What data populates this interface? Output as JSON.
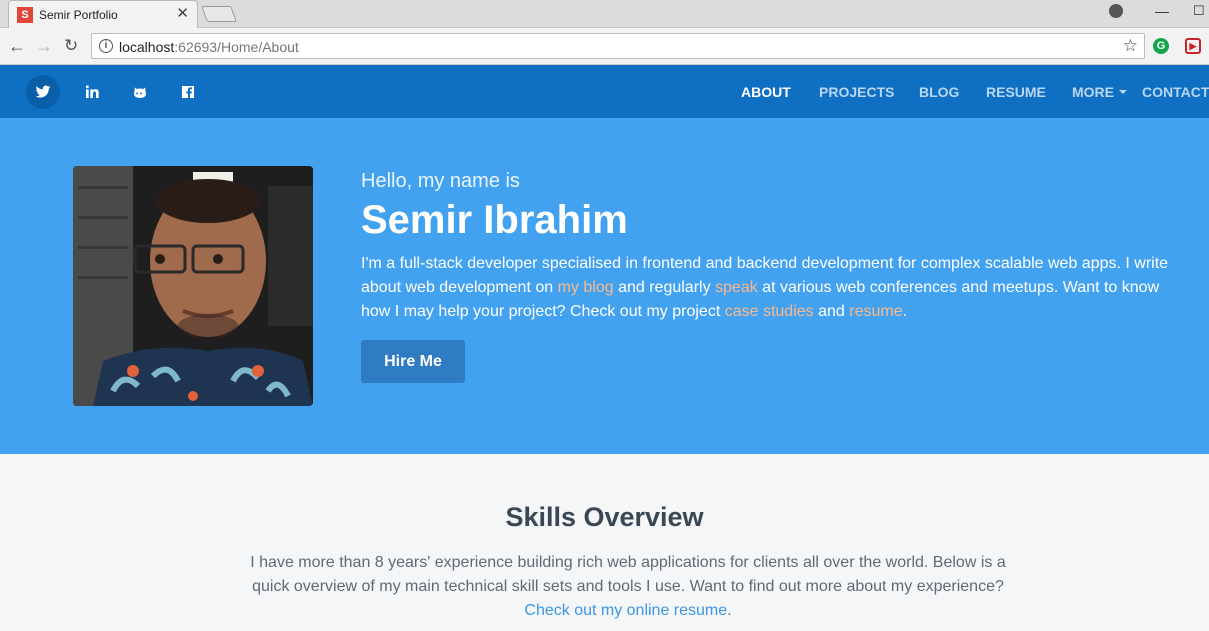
{
  "browser": {
    "tab_title": "Semir Portfolio",
    "tab_close": "✕",
    "favicon_letter": "S",
    "url_host": "localhost",
    "url_rest": ":62693/Home/About",
    "minimize": "—",
    "maximize": "☐",
    "close": "✕"
  },
  "nav": {
    "social_icons": [
      "twitter-icon",
      "linkedin-icon",
      "github-icon",
      "facebook-icon"
    ],
    "links": {
      "about": "ABOUT",
      "projects": "PROJECTS",
      "blog": "BLOG",
      "resume": "RESUME",
      "more": "MORE",
      "contact": "CONTACT"
    }
  },
  "hero": {
    "greeting": "Hello, my name is",
    "name": "Semir Ibrahim",
    "intro_1": "I'm a full-stack developer specialised in frontend and backend development for complex scalable web apps. I write about web development on ",
    "link_blog": "my blog",
    "intro_2": " and regularly ",
    "link_speak": "speak",
    "intro_3": " at various web conferences and meetups. Want to know how I may help your project? Check out my project ",
    "link_case": "case studies",
    "intro_4": " and ",
    "link_resume": "resume",
    "intro_5": ".",
    "hire_button": "Hire Me"
  },
  "skills": {
    "title": "Skills Overview",
    "text": "I have more than 8 years' experience building rich web applications for clients all over the world. Below is a quick overview of my main technical skill sets and tools I use. Want to find out more about my experience?",
    "link": "Check out my online resume",
    "end": "."
  },
  "colors": {
    "nav_bg": "#0e6fc3",
    "hero_bg": "#43a2f0",
    "link_accent": "#f9b98a",
    "button_bg": "#2f7cc3"
  }
}
